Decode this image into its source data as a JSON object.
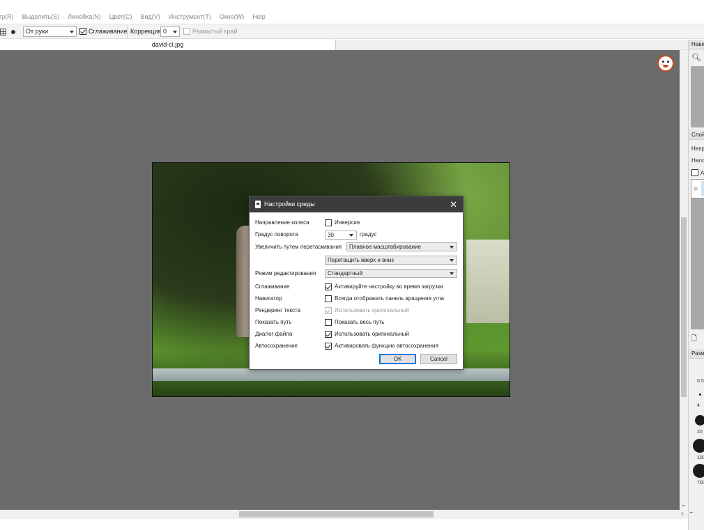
{
  "menu": [
    "тр(R)",
    "Выделить(S)",
    "Линейка(N)",
    "Цвет(C)",
    "Вид(V)",
    "Инструмент(T)",
    "Окно(W)",
    "Help"
  ],
  "toolbar": {
    "mode": "От руки",
    "smoothing_label": "Сглаживание",
    "correction_label": "Коррекция",
    "correction_value": "0",
    "blur_edge_label": "Размытый край"
  },
  "tab": {
    "filename": "david-cl.jpg"
  },
  "dialog": {
    "title": "Настройки среды",
    "rows": {
      "wheel_direction": {
        "label": "Направление колеса",
        "value": "Инверсия"
      },
      "rotation_step": {
        "label": "Градус поворота",
        "value": "30",
        "unit": "градус"
      },
      "drag_zoom": {
        "label": "Увеличить путем перетаскивания",
        "value": "Плавное масштабирование",
        "value2": "Перетащить вверх и вниз"
      },
      "edit_mode": {
        "label": "Режим редактирования",
        "value": "Стандартный"
      },
      "antialias": {
        "label": "Сглаживание",
        "value": "Активируйте настройку во время загрузки"
      },
      "navigator": {
        "label": "Навигатор",
        "value": "Всегда отображать панель вращения угла"
      },
      "text_render": {
        "label": "Рендеринг текста",
        "value": "Использовать оригинальный"
      },
      "show_path": {
        "label": "Показать путь",
        "value": "Показать весь путь"
      },
      "file_dialog": {
        "label": "Диалог файла",
        "value": "Использовать оригинальный"
      },
      "autosave": {
        "label": "Автосохранение",
        "value": "Активировать функцию автосохранения"
      }
    },
    "ok_label": "OK",
    "cancel_label": "Cancel"
  },
  "right_panel": {
    "nav_header": "Нави",
    "layers_header": "Слой",
    "layers_opacity": "Непр",
    "layers_blend": "Нало",
    "layers_lock": "А",
    "brush_header": "Разм",
    "brush_sizes": [
      "0.5",
      "4",
      "20",
      "100",
      "700"
    ]
  },
  "colors": {
    "canvas_bg": "#6b6b6b",
    "dialog_title_bg": "#3c3c3c",
    "accent": "#0078d7"
  }
}
